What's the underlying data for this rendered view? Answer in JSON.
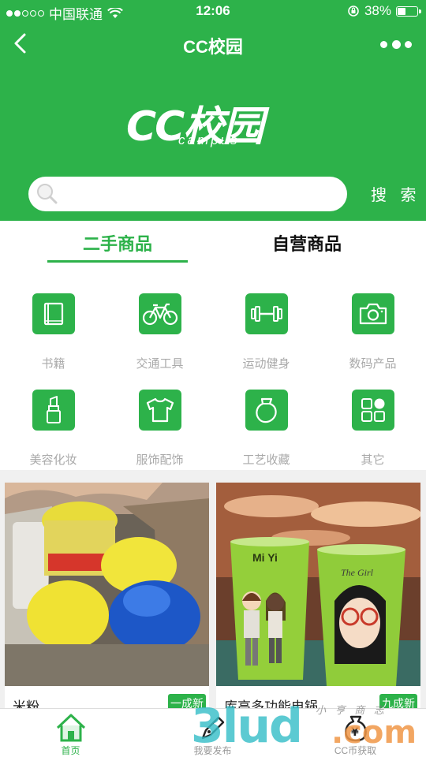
{
  "status_bar": {
    "carrier": "中国联通",
    "time": "12:06",
    "battery": "38%",
    "battery_level": 0.38
  },
  "nav": {
    "title": "CC校园",
    "back_icon": "chevron-left-icon",
    "more_icon": "more-dots-icon"
  },
  "logo": {
    "main": "CC校园",
    "sub": "campus"
  },
  "search": {
    "placeholder": "",
    "value": "",
    "button_label": "搜 索"
  },
  "tabs": [
    {
      "label": "二手商品",
      "active": true
    },
    {
      "label": "自营商品",
      "active": false
    }
  ],
  "categories": [
    {
      "label": "书籍",
      "icon": "book-icon"
    },
    {
      "label": "交通工具",
      "icon": "bicycle-icon"
    },
    {
      "label": "运动健身",
      "icon": "dumbbell-icon"
    },
    {
      "label": "数码产品",
      "icon": "camera-icon"
    },
    {
      "label": "美容化妆",
      "icon": "lipstick-icon"
    },
    {
      "label": "服饰配饰",
      "icon": "tshirt-icon"
    },
    {
      "label": "工艺收藏",
      "icon": "vase-icon"
    },
    {
      "label": "其它",
      "icon": "grid-icon"
    }
  ],
  "products": [
    {
      "title": "米粉",
      "condition": "一成新"
    },
    {
      "title": "库高多功能电锅",
      "condition": "九成新",
      "cup_text_1": "Mi Yi",
      "cup_text_2": "The Girl"
    }
  ],
  "tabbar": [
    {
      "label": "首页",
      "icon": "home-icon",
      "active": true
    },
    {
      "label": "我要发布",
      "icon": "publish-pen-icon",
      "active": false
    },
    {
      "label": "CC币获取",
      "icon": "money-bag-icon",
      "active": false
    }
  ],
  "watermark": {
    "text": "3lud",
    "suffix": ".com",
    "handwriting": "小 亨 商 志"
  },
  "colors": {
    "brand_green": "#2db24a",
    "category_label": "#aaaaaa"
  }
}
